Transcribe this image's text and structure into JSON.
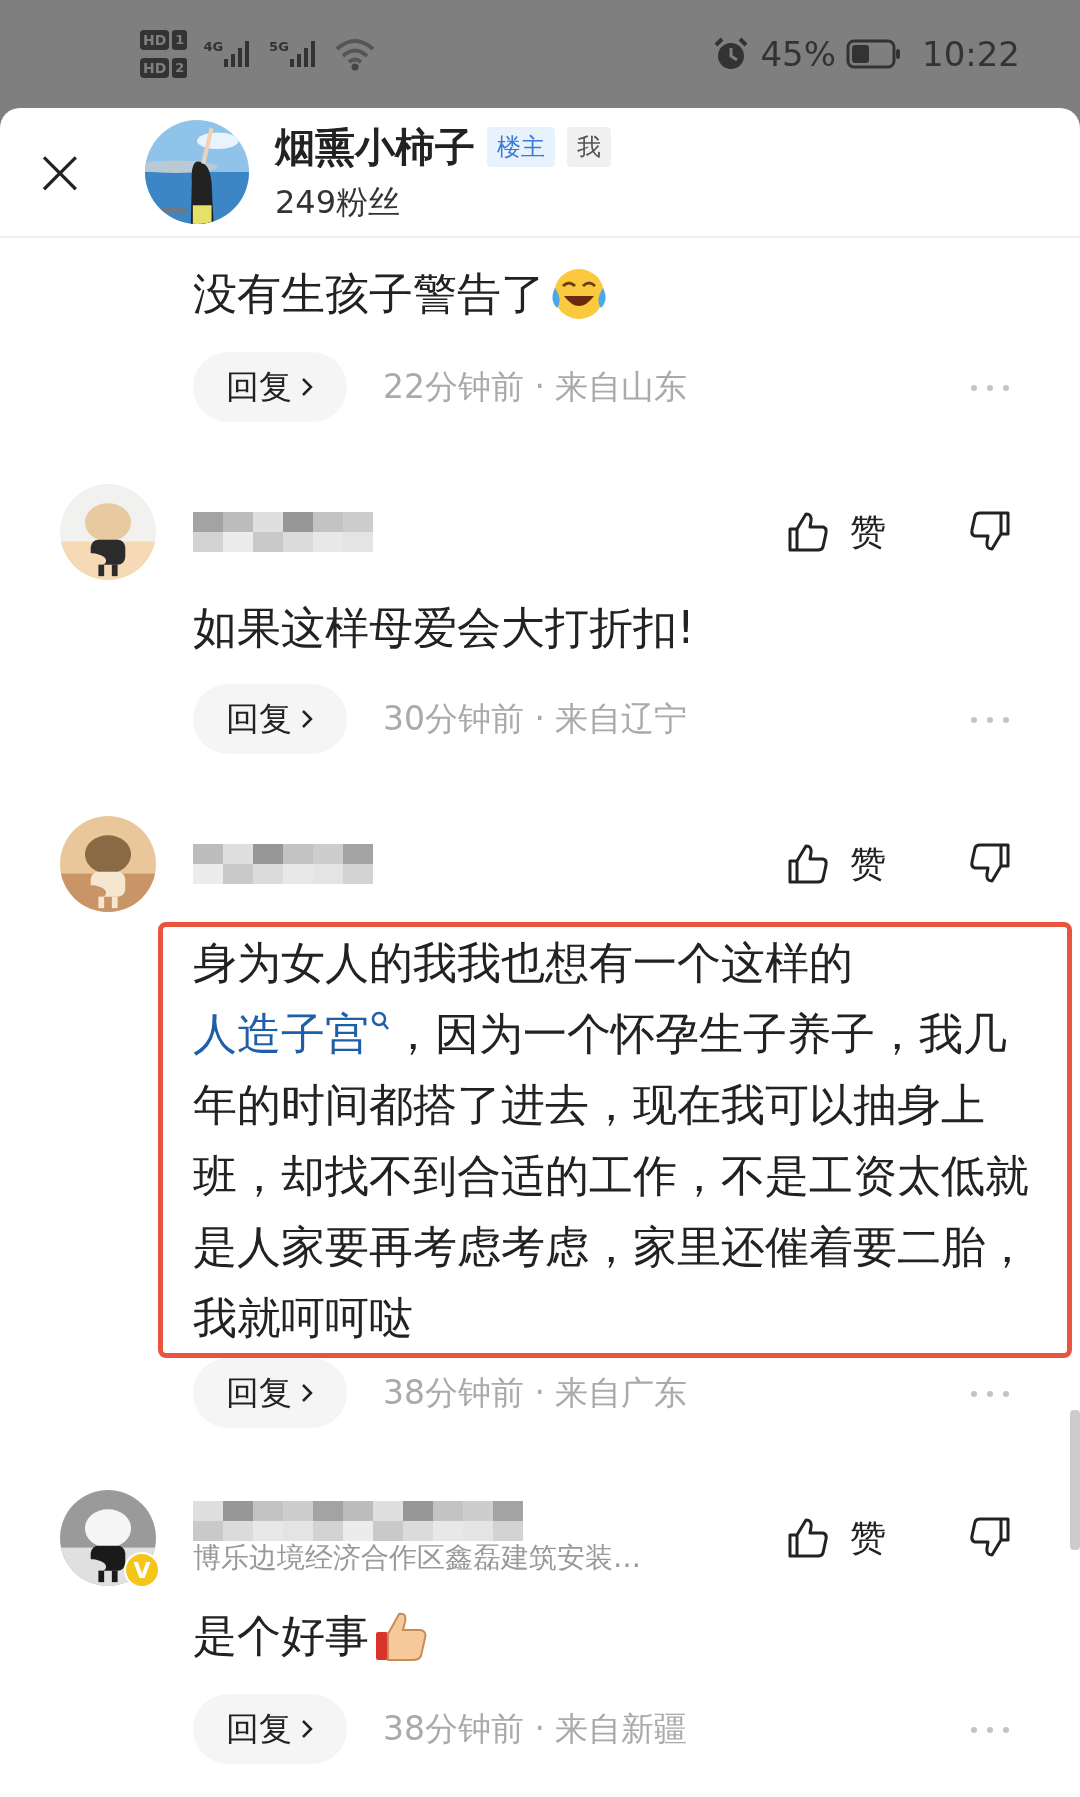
{
  "status_bar": {
    "sims": [
      {
        "label": "HD",
        "slot": "1"
      },
      {
        "label": "HD",
        "slot": "2"
      }
    ],
    "networks": [
      "4G",
      "5G"
    ],
    "battery_text": "45%",
    "time": "10:22"
  },
  "header": {
    "close": "×",
    "name": "烟熏小柿子",
    "badges": [
      {
        "label": "楼主",
        "kind": "owner"
      },
      {
        "label": "我",
        "kind": "me"
      }
    ],
    "fans": "249粉丝"
  },
  "comments": [
    {
      "kind": "partial",
      "segments": [
        {
          "kind": "plain",
          "text": "没有生孩子警告了"
        }
      ],
      "emoji": true,
      "reply_label": "回复",
      "meta": "22分钟前 · 来自山东"
    },
    {
      "kind": "full",
      "like_label": "赞",
      "segments": [
        {
          "kind": "plain",
          "text": "如果这样母爱会大打折扣!"
        }
      ],
      "reply_label": "回复",
      "meta": "30分钟前 · 来自辽宁"
    },
    {
      "kind": "full",
      "like_label": "赞",
      "highlighted": true,
      "segments": [
        {
          "kind": "plain",
          "text": "身为女人的我我也想有一个这样的"
        },
        {
          "kind": "link",
          "text": "人造子宫"
        },
        {
          "kind": "plain",
          "text": "，因为一个怀孕生子养子，我几年的时间都搭了进去，现在我可以抽身上班，却找不到合适的工作，不是工资太低就是人家要再考虑考虑，家里还催着要二胎，我就呵呵哒"
        }
      ],
      "reply_label": "回复",
      "meta": "38分钟前 · 来自广东"
    },
    {
      "kind": "full",
      "verified_badge": "V",
      "subtitle": "博乐边境经济合作区鑫磊建筑安装…",
      "like_label": "赞",
      "segments": [
        {
          "kind": "plain",
          "text": "是个好事"
        }
      ],
      "emoji": true,
      "reply_label": "回复",
      "meta": "38分钟前 · 来自新疆"
    }
  ]
}
